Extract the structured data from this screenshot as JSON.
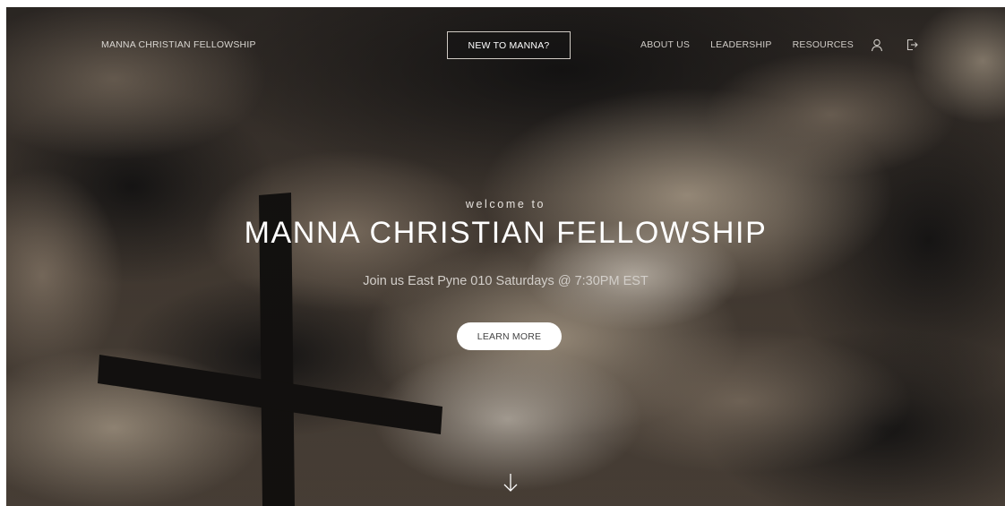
{
  "nav": {
    "brand": "MANNA CHRISTIAN FELLOWSHIP",
    "cta": "NEW TO MANNA?",
    "links": [
      {
        "label": "ABOUT US"
      },
      {
        "label": "LEADERSHIP"
      },
      {
        "label": "RESOURCES"
      }
    ],
    "icons": [
      "user-icon",
      "logout-icon"
    ]
  },
  "hero": {
    "eyebrow": "welcome to",
    "title": "MANNA CHRISTIAN FELLOWSHIP",
    "subtitle": "Join us East Pyne 010 Saturdays @ 7:30PM EST",
    "button": "LEARN MORE",
    "scroll_icon": "arrow-down-icon"
  },
  "colors": {
    "text_primary": "#ffffff",
    "text_muted": "#cfcbc6",
    "button_bg": "#ffffff",
    "button_text": "#444444",
    "sky_dark": "#1e1c1b",
    "sky_light": "#a89886"
  }
}
